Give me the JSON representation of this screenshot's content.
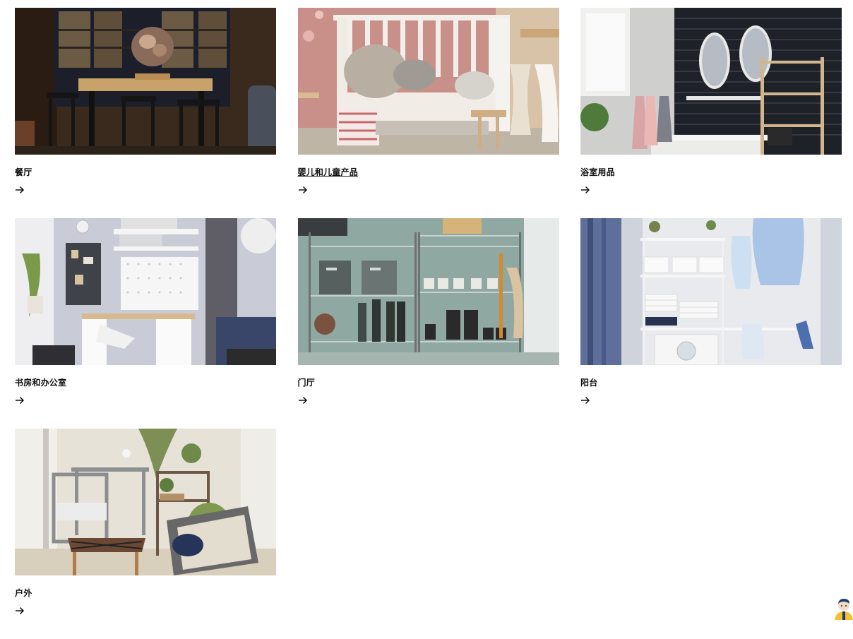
{
  "categories": [
    {
      "label": "餐厅",
      "icon": "arrow-right-icon",
      "image": "dining-room-photo"
    },
    {
      "label": "婴儿和儿童产品",
      "icon": "arrow-right-icon",
      "image": "baby-room-photo",
      "underlined": true
    },
    {
      "label": "浴室用品",
      "icon": "arrow-right-icon",
      "image": "bathroom-photo"
    },
    {
      "label": "书房和办公室",
      "icon": "arrow-right-icon",
      "image": "home-office-photo"
    },
    {
      "label": "门厅",
      "icon": "arrow-right-icon",
      "image": "hallway-photo"
    },
    {
      "label": "阳台",
      "icon": "arrow-right-icon",
      "image": "balcony-photo"
    },
    {
      "label": "户外",
      "icon": "arrow-right-icon",
      "image": "outdoor-photo"
    }
  ],
  "assistant": {
    "icon": "chat-assistant-avatar-icon"
  }
}
